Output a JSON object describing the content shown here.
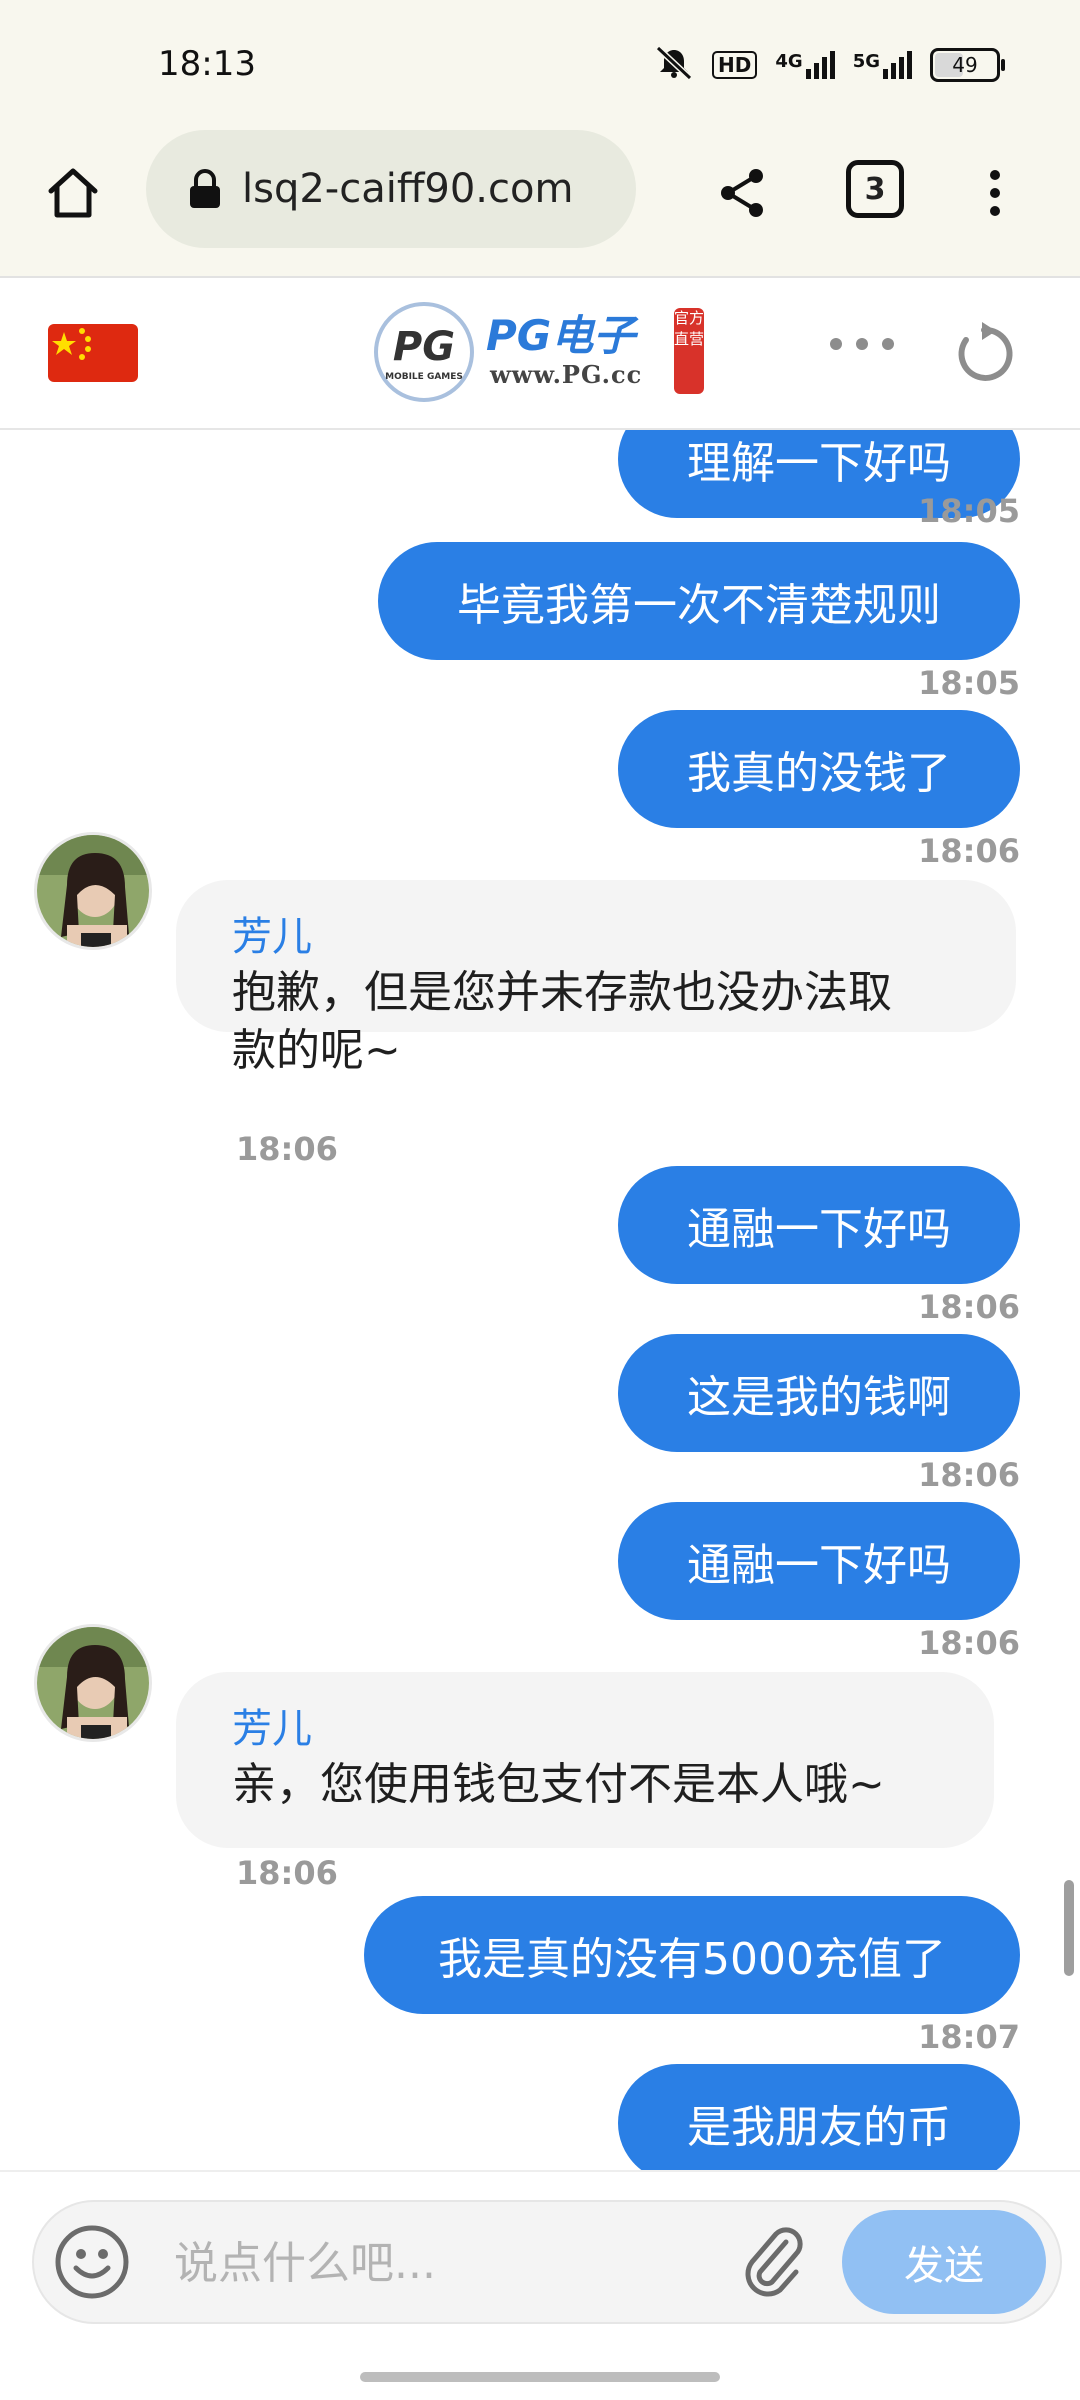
{
  "status_bar": {
    "time": "18:13",
    "network_hd": "HD",
    "network_4g": "4G",
    "network_5g": "5G",
    "battery": "49"
  },
  "browser": {
    "url": "lsq2-caiff90.com",
    "tab_count": "3"
  },
  "site_header": {
    "logo_mark": "PG",
    "logo_mark_sub": "MOBILE GAMES",
    "logo_brand": "PG电子",
    "logo_domain": "www.PG.cc",
    "logo_seal": "官方直营"
  },
  "colors": {
    "accent": "#2a7fe5",
    "send_disabled": "#91c0f3",
    "bubble_in_bg": "#f4f4f4",
    "timestamp": "#9a9a9a"
  },
  "messages": [
    {
      "dir": "out",
      "text": "理解一下好吗",
      "time": "18:05"
    },
    {
      "dir": "out",
      "text": "毕竟我第一次不清楚规则",
      "time": "18:05"
    },
    {
      "dir": "out",
      "text": "我真的没钱了",
      "time": "18:06"
    },
    {
      "dir": "in",
      "name": "芳儿",
      "text_line1": "抱歉，但是您并未存款也没办法取",
      "text_line2": "款的呢~",
      "time": "18:06"
    },
    {
      "dir": "out",
      "text": "通融一下好吗",
      "time": "18:06"
    },
    {
      "dir": "out",
      "text": "这是我的钱啊",
      "time": "18:06"
    },
    {
      "dir": "out",
      "text": "通融一下好吗",
      "time": "18:06"
    },
    {
      "dir": "in",
      "name": "芳儿",
      "text_line1": "亲，您使用钱包支付不是本人哦~",
      "time": "18:06"
    },
    {
      "dir": "out",
      "text": "我是真的没有5000充值了",
      "time": "18:07"
    },
    {
      "dir": "out",
      "text": "是我朋友的币"
    }
  ],
  "composer": {
    "placeholder": "说点什么吧...",
    "send_label": "发送"
  }
}
